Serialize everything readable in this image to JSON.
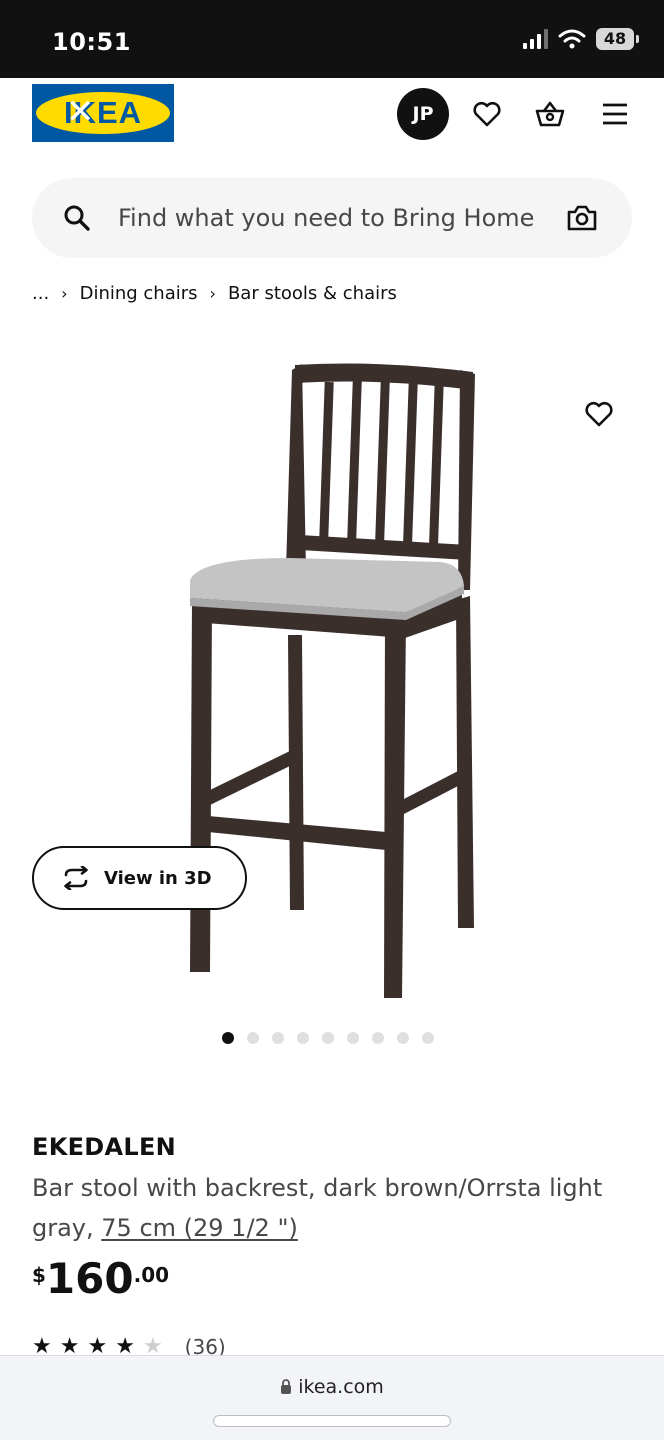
{
  "status_bar": {
    "time": "10:51",
    "battery": "48"
  },
  "header": {
    "logo_text": "IKEA",
    "avatar_initials": "JP"
  },
  "search": {
    "placeholder": "Find what you need to Bring Home"
  },
  "breadcrumb": {
    "ellipsis": "...",
    "items": [
      "Dining chairs",
      "Bar stools & chairs"
    ]
  },
  "product": {
    "view_3d_label": "View in 3D",
    "image_count": 9,
    "active_image": 1,
    "name": "EKEDALEN",
    "description": "Bar stool with backrest, dark brown/Orrsta light gray, ",
    "size_link": "75 cm (29 1/2 \")",
    "price": {
      "currency": "$",
      "integer": "160",
      "cents": ".00"
    },
    "rating": {
      "stars": 4,
      "max_stars": 5,
      "count": "(36)"
    }
  },
  "browser": {
    "url": "ikea.com"
  },
  "colors": {
    "ikea_blue": "#0058a3",
    "ikea_yellow": "#ffdb00",
    "chair_wood": "#3b2f2c",
    "seat_fabric": "#c4c4c4"
  }
}
